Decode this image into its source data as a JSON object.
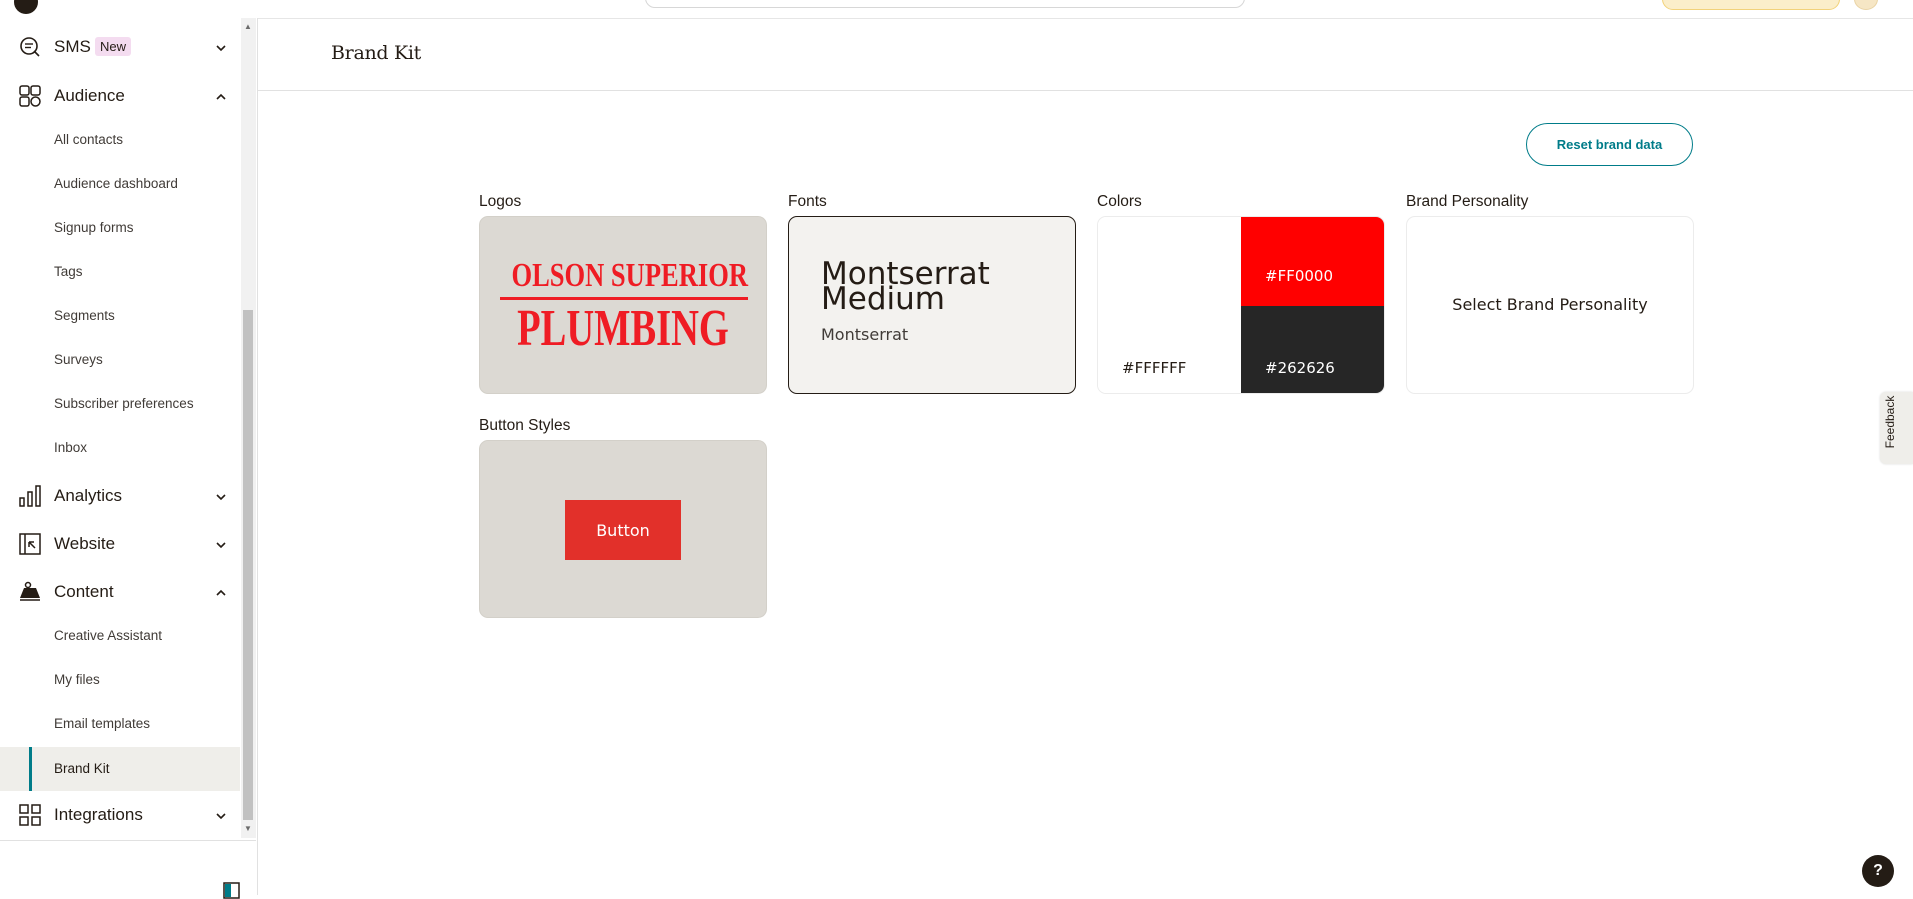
{
  "sidebar": {
    "sms": {
      "label": "SMS",
      "badge": "New"
    },
    "audience": {
      "label": "Audience",
      "items": [
        "All contacts",
        "Audience dashboard",
        "Signup forms",
        "Tags",
        "Segments",
        "Surveys",
        "Subscriber preferences",
        "Inbox"
      ]
    },
    "analytics": {
      "label": "Analytics"
    },
    "website": {
      "label": "Website"
    },
    "content": {
      "label": "Content",
      "items": [
        "Creative Assistant",
        "My files",
        "Email templates",
        "Brand Kit"
      ],
      "active_item": "Brand Kit"
    },
    "integrations": {
      "label": "Integrations"
    }
  },
  "page": {
    "title": "Brand Kit",
    "reset_label": "Reset brand data"
  },
  "sections": {
    "logos": {
      "label": "Logos",
      "logo_line1": "OLSON SUPERIOR",
      "logo_line2": "PLUMBING"
    },
    "fonts": {
      "label": "Fonts",
      "sample": "Montserrat Medium",
      "name": "Montserrat"
    },
    "colors": {
      "label": "Colors",
      "swatches": [
        {
          "hex": "#FFFFFF",
          "text_color": "#241c15"
        },
        {
          "hex": "#FF0000",
          "text_color": "#ffffff"
        },
        {
          "hex": "#262626",
          "text_color": "#ffffff"
        }
      ]
    },
    "personality": {
      "label": "Brand Personality",
      "placeholder": "Select Brand Personality"
    },
    "button_styles": {
      "label": "Button Styles",
      "button_label": "Button",
      "button_color": "#E2302A"
    }
  },
  "feedback_label": "Feedback",
  "help_label": "?",
  "colors": {
    "accent": "#007c89",
    "text": "#241c15",
    "card_bg": "#dcd9d3"
  }
}
